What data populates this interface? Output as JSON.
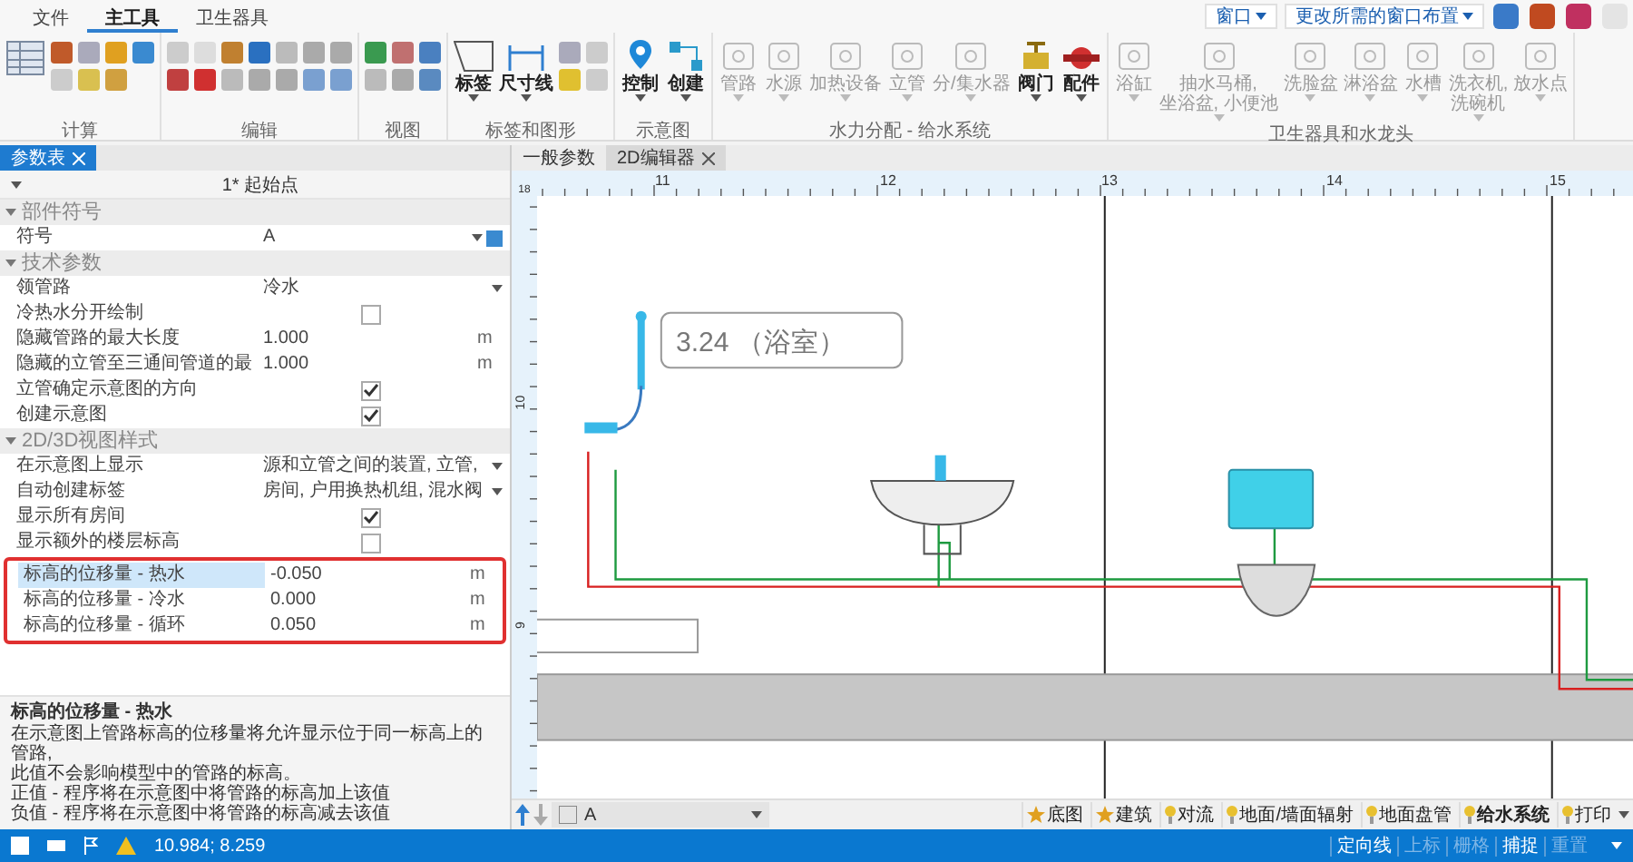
{
  "menu_tabs": [
    {
      "label": "文件",
      "selected": false
    },
    {
      "label": "主工具",
      "selected": true
    },
    {
      "label": "卫生器具",
      "selected": false
    }
  ],
  "window_menus": [
    "窗口",
    "更改所需的窗口布置"
  ],
  "ribbon_groups": [
    {
      "title": "计算"
    },
    {
      "title": "编辑"
    },
    {
      "title": "视图"
    },
    {
      "title": "标签和图形",
      "buttons": [
        {
          "label": "标签",
          "disabled": false
        },
        {
          "label": "尺寸线",
          "disabled": false
        }
      ]
    },
    {
      "title": "示意图",
      "buttons": [
        {
          "label": "控制",
          "disabled": false
        },
        {
          "label": "创建",
          "disabled": false
        }
      ]
    },
    {
      "title": "水力分配 - 给水系统",
      "buttons": [
        {
          "label": "管路",
          "disabled": true
        },
        {
          "label": "水源",
          "disabled": true
        },
        {
          "label": "加热设备",
          "disabled": true
        },
        {
          "label": "立管",
          "disabled": true
        },
        {
          "label": "分/集水器",
          "disabled": true
        },
        {
          "label": "阀门",
          "disabled": false
        },
        {
          "label": "配件",
          "disabled": false
        }
      ]
    },
    {
      "title": "卫生器具和水龙头",
      "buttons": [
        {
          "label": "浴缸",
          "disabled": true
        },
        {
          "label": "抽水马桶,\n坐浴盆, 小便池",
          "disabled": true
        },
        {
          "label": "洗脸盆",
          "disabled": true
        },
        {
          "label": "淋浴盆",
          "disabled": true
        },
        {
          "label": "水槽",
          "disabled": true
        },
        {
          "label": "洗衣机,\n洗碗机",
          "disabled": true
        },
        {
          "label": "放水点",
          "disabled": true
        }
      ]
    }
  ],
  "panel": {
    "tab": "参数表",
    "header": "1* 起始点",
    "sections": [
      {
        "title": "部件符号",
        "rows": [
          {
            "label": "符号",
            "kind": "symbol",
            "value": "A",
            "selected": false
          }
        ]
      },
      {
        "title": "技术参数",
        "rows": [
          {
            "label": "领管路",
            "kind": "dropdown",
            "value": "冷水",
            "selected": false
          },
          {
            "label": "冷热水分开绘制",
            "kind": "check",
            "checked": false,
            "selected": false
          },
          {
            "label": "隐藏管路的最大长度",
            "kind": "number",
            "value": "1.000",
            "unit": "m",
            "selected": false
          },
          {
            "label": "隐藏的立管至三通间管道的最",
            "kind": "number",
            "value": "1.000",
            "unit": "m",
            "selected": false
          },
          {
            "label": "立管确定示意图的方向",
            "kind": "check",
            "checked": true,
            "selected": false
          },
          {
            "label": "创建示意图",
            "kind": "check",
            "checked": true,
            "selected": false
          }
        ]
      },
      {
        "title": "2D/3D视图样式",
        "rows": [
          {
            "label": "在示意图上显示",
            "kind": "dropdown",
            "value": "源和立管之间的装置, 立管,",
            "selected": false
          },
          {
            "label": "自动创建标签",
            "kind": "dropdown",
            "value": "房间, 户用换热机组, 混水阀",
            "selected": false
          },
          {
            "label": "显示所有房间",
            "kind": "check",
            "checked": true,
            "selected": false
          },
          {
            "label": "显示额外的楼层标高",
            "kind": "check",
            "checked": false,
            "selected": false
          },
          {
            "label": "标高的位移量 - 热水",
            "kind": "number",
            "value": "-0.050",
            "unit": "m",
            "selected": true,
            "framed": true
          },
          {
            "label": "标高的位移量 - 冷水",
            "kind": "number",
            "value": "0.000",
            "unit": "m",
            "selected": false,
            "framed": true
          },
          {
            "label": "标高的位移量 - 循环",
            "kind": "number",
            "value": "0.050",
            "unit": "m",
            "selected": false,
            "framed": true
          }
        ]
      }
    ],
    "description": {
      "title": "标高的位移量 - 热水",
      "lines": [
        "在示意图上管路标高的位移量将允许显示位于同一标高上的管路,",
        "此值不会影响模型中的管路的标高。",
        "正值 - 程序将在示意图中将管路的标高加上该值",
        "负值 - 程序将在示意图中将管路的标高减去该值"
      ]
    }
  },
  "doc_tabs": [
    {
      "label": "一般参数",
      "selected": false
    },
    {
      "label": "2D编辑器",
      "selected": true
    }
  ],
  "ruler": {
    "corner": "18",
    "x_labels": [
      "11",
      "12",
      "13",
      "14",
      "15"
    ],
    "y_labels": [
      "10",
      "9"
    ]
  },
  "room_label": "3.24 （浴室）",
  "layer_bar": {
    "layer": "A",
    "layers": [
      {
        "label": "底图",
        "kind": "star",
        "selected": false
      },
      {
        "label": "建筑",
        "kind": "star",
        "selected": false
      },
      {
        "label": "对流",
        "kind": "bulb",
        "selected": false
      },
      {
        "label": "地面/墙面辐射",
        "kind": "bulb",
        "selected": false
      },
      {
        "label": "地面盘管",
        "kind": "bulb",
        "selected": false
      },
      {
        "label": "给水系统",
        "kind": "bulb",
        "selected": true
      },
      {
        "label": "打印",
        "kind": "bulb",
        "selected": false
      }
    ]
  },
  "status_bar": {
    "coords": "10.984; 8.259",
    "toggles": [
      {
        "label": "定向线",
        "on": true
      },
      {
        "label": "上标",
        "on": false
      },
      {
        "label": "栅格",
        "on": false
      },
      {
        "label": "捕捉",
        "on": true
      },
      {
        "label": "重置",
        "on": false
      }
    ]
  }
}
